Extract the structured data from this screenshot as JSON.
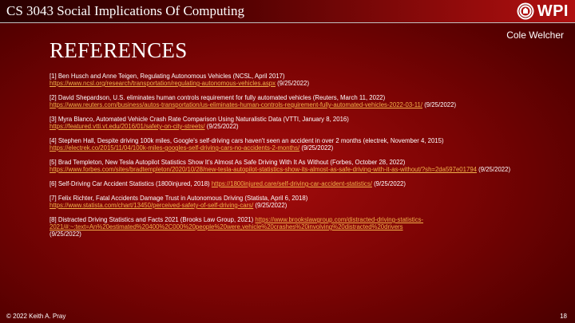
{
  "header": {
    "course_title": "CS 3043 Social Implications Of Computing",
    "logo_text": "WPI"
  },
  "author": "Cole Welcher",
  "heading": "REFERENCES",
  "references": [
    {
      "citation": "[1] Ben Husch and Anne Teigen, Regulating Autonomous Vehicles (NCSL, April 2017)",
      "url": "https://www.ncsl.org/research/transportation/regulating-autonomous-vehicles.aspx",
      "accessed": "(9/25/2022)"
    },
    {
      "citation": "[2] David Shepardson, U.S. eliminates human controls requirement for fully automated vehicles (Reuters, March 11, 2022)",
      "url": "https://www.reuters.com/business/autos-transportation/us-eliminates-human-controls-requirement-fully-automated-vehicles-2022-03-11/",
      "accessed": "(9/25/2022)"
    },
    {
      "citation": "[3] Myra Blanco, Automated Vehicle Crash Rate Comparison Using Naturalistic Data (VTTI, January 8, 2016)",
      "url": "https://featured.vtti.vt.edu/2016/01/safety-on-city-streets/",
      "accessed": "(9/25/2022)"
    },
    {
      "citation": "[4] Stephen Hall, Despite driving 100k miles, Google's self-driving cars haven't seen an accident in over 2 months (electrek, November 4, 2015)",
      "url": "https://electrek.co/2015/11/04/100k-miles-googles-self-driving-cars-no-accidents-2-months/",
      "accessed": "(9/25/2022)"
    },
    {
      "citation": "[5] Brad Templeton, New Tesla Autopilot Statistics Show It's Almost As Safe Driving With It As Without (Forbes, October 28, 2022)",
      "url": "https://www.forbes.com/sites/bradtempleton/2020/10/28/new-tesla-autopilot-statistics-show-its-almost-as-safe-driving-with-it-as-without/?sh=2da597e01794",
      "accessed": "(9/25/2022)"
    },
    {
      "citation": "[6] Self-Driving Car Accident Statistics (1800injured, 2018)",
      "url": "https://1800injured.care/self-driving-car-accident-statistics/",
      "accessed": "(9/25/2022)"
    },
    {
      "citation": "[7] Felix Richter, Fatal Accidents Damage Trust in Autonomous Driving (Statista, April 6, 2018)",
      "url": "https://www.statista.com/chart/13450/perceived-safety-of-self-driving-cars/",
      "accessed": "(9/25/2022)"
    },
    {
      "citation": "[8] Distracted Driving Statistics and Facts 2021 (Brooks Law Group, 2021)",
      "url": "https://www.brookslawgroup.com/distracted-driving-statistics-2021/#:~:text=An%20estimated%20400%2C000%20people%20were,vehicle%20crashes%20involving%20distracted%20drivers",
      "accessed": "(9/25/2022)"
    }
  ],
  "footer": {
    "copyright": "© 2022 Keith A. Pray",
    "page_number": "18"
  },
  "colors": {
    "background": "#7c0404",
    "link": "#f2b24a",
    "text": "#ffffff"
  },
  "icons": {
    "logo": "wpi-seal-icon"
  }
}
